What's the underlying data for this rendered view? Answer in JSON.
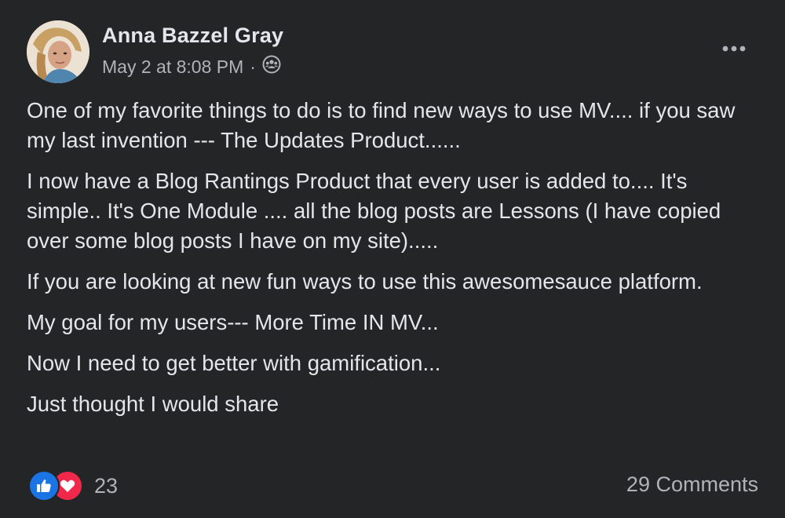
{
  "post": {
    "author": "Anna Bazzel Gray",
    "timestamp": "May 2 at 8:08 PM",
    "separator": "·",
    "audience_icon": "group-audience-icon",
    "paragraphs": [
      "One of my favorite things to do is to find new ways to use MV.... if you saw my last invention --- The Updates Product......",
      "I now have a Blog Rantings Product that every user is added to.... It's simple.. It's One Module .... all the blog posts are Lessons (I have copied over some blog posts I have on my site).....",
      "If you are looking at new fun ways to use this awesomesauce platform.",
      "My goal for my users--- More Time IN MV...",
      "Now I need to get better with gamification...",
      "Just thought I would share"
    ],
    "reaction_count": "23",
    "comments_label": "29 Comments"
  },
  "colors": {
    "background": "#242526",
    "primary_text": "#e4e6eb",
    "secondary_text": "#b0b3b8",
    "like_blue": "#1b74e4",
    "love_red": "#f0284a"
  }
}
